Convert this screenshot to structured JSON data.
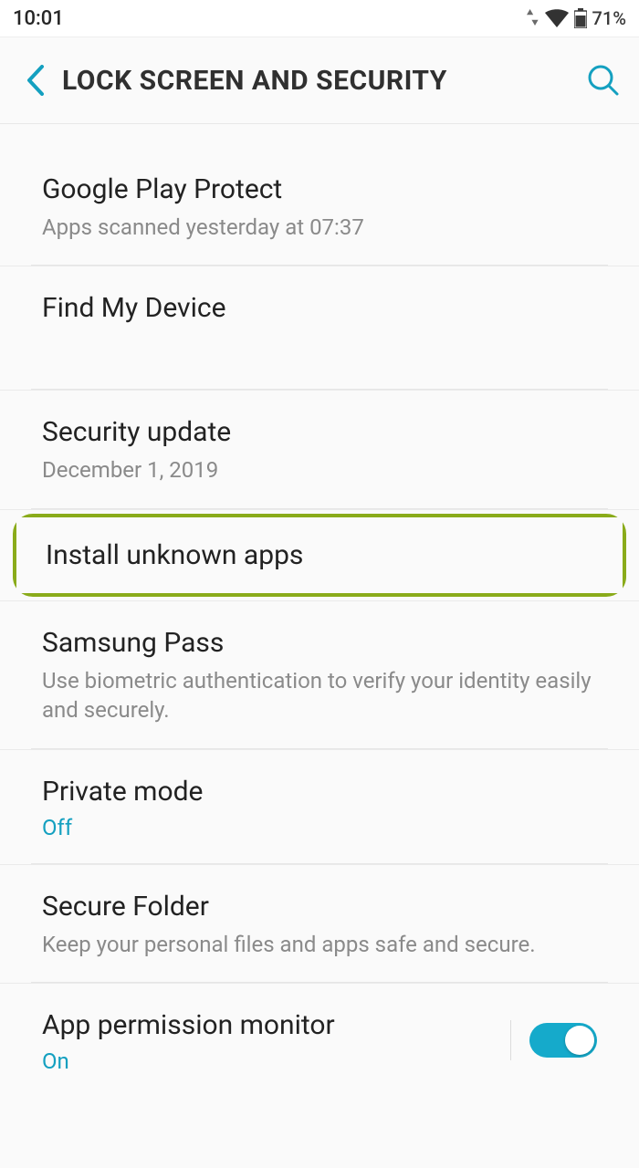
{
  "status_bar": {
    "time": "10:01",
    "battery_percent": "71%"
  },
  "header": {
    "title": "LOCK SCREEN AND SECURITY"
  },
  "items": {
    "google_play_protect": {
      "title": "Google Play Protect",
      "subtitle": "Apps scanned yesterday at 07:37"
    },
    "find_my_device": {
      "title": "Find My Device"
    },
    "security_update": {
      "title": "Security update",
      "subtitle": "December 1, 2019"
    },
    "install_unknown_apps": {
      "title": "Install unknown apps"
    },
    "samsung_pass": {
      "title": "Samsung Pass",
      "subtitle": "Use biometric authentication to verify your identity easily and securely."
    },
    "private_mode": {
      "title": "Private mode",
      "status": "Off"
    },
    "secure_folder": {
      "title": "Secure Folder",
      "subtitle": "Keep your personal files and apps safe and secure."
    },
    "app_permission_monitor": {
      "title": "App permission monitor",
      "status": "On"
    }
  },
  "colors": {
    "accent": "#14a0c0",
    "highlight_border": "#8aab1a"
  }
}
